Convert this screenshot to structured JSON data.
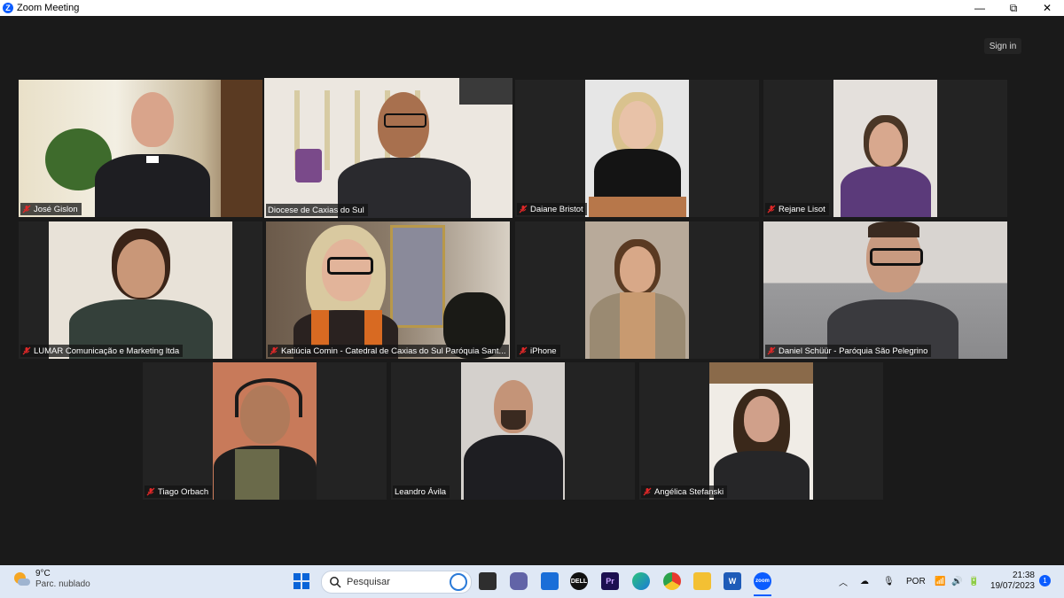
{
  "window": {
    "title": "Zoom Meeting",
    "minimize": "—",
    "maximize": "⧉",
    "close": "✕"
  },
  "header": {
    "sign_in_label": "Sign in"
  },
  "participants": [
    {
      "name": "José Gislon",
      "muted": true
    },
    {
      "name": "Diocese de Caxias do Sul",
      "muted": false,
      "active_speaker": true
    },
    {
      "name": "Daiane Bristot",
      "muted": true
    },
    {
      "name": "Rejane Lisot",
      "muted": true
    },
    {
      "name": "LUMAR Comunicação e Marketing ltda",
      "muted": true
    },
    {
      "name": "Katiúcia Comin - Catedral de Caxias do Sul Paróquia Sant...",
      "muted": true
    },
    {
      "name": "iPhone",
      "muted": true
    },
    {
      "name": "Daniel Schüür - Paróquia São Pelegrino",
      "muted": true
    },
    {
      "name": "Tiago Orbach",
      "muted": true
    },
    {
      "name": "Leandro Ávila",
      "muted": false
    },
    {
      "name": "Angélica Stefanski",
      "muted": true
    }
  ],
  "taskbar": {
    "weather": {
      "temp": "9°C",
      "condition": "Parc. nublado"
    },
    "search_placeholder": "Pesquisar",
    "language": "POR",
    "time": "21:38",
    "date": "19/07/2023",
    "notifications": "1",
    "apps": [
      "windows-start",
      "search",
      "task-view",
      "teams",
      "store",
      "dell",
      "premiere",
      "edge",
      "chrome",
      "file-explorer",
      "word",
      "zoom"
    ]
  },
  "colors": {
    "active_speaker_border": "#b9d44f",
    "mute_icon": "#e02828",
    "zoom_blue": "#0b5cff"
  }
}
